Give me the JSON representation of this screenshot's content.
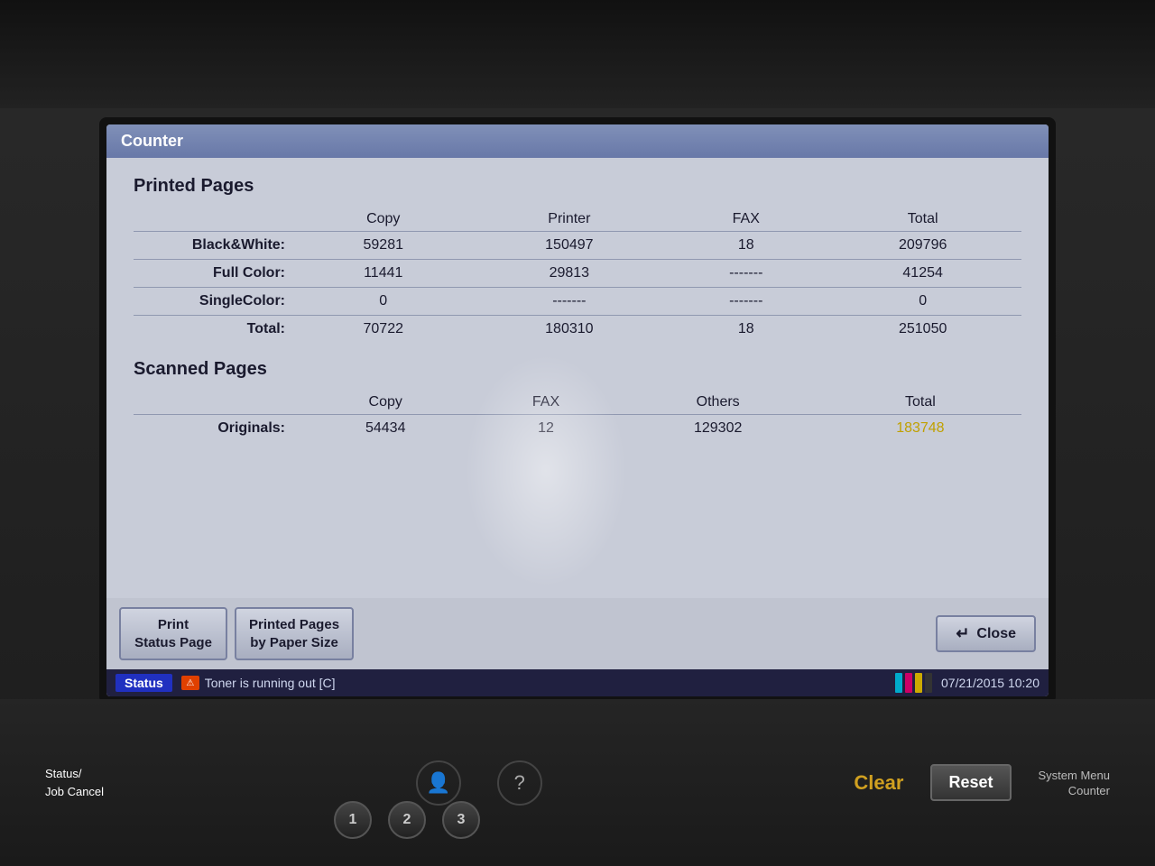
{
  "device": {
    "screen": {
      "title": "Counter",
      "titleBar": {
        "label": "Counter"
      },
      "printedPages": {
        "heading": "Printed Pages",
        "columns": [
          "",
          "Copy",
          "Printer",
          "FAX",
          "Total"
        ],
        "rows": [
          {
            "label": "Black&White:",
            "copy": "59281",
            "printer": "150497",
            "fax": "18",
            "total": "209796"
          },
          {
            "label": "Full Color:",
            "copy": "11441",
            "printer": "29813",
            "fax": "-------",
            "total": "41254"
          },
          {
            "label": "SingleColor:",
            "copy": "0",
            "printer": "-------",
            "fax": "-------",
            "total": "0"
          },
          {
            "label": "Total:",
            "copy": "70722",
            "printer": "180310",
            "fax": "18",
            "total": "251050"
          }
        ]
      },
      "scannedPages": {
        "heading": "Scanned Pages",
        "columns": [
          "",
          "Copy",
          "FAX",
          "Others",
          "Total"
        ],
        "rows": [
          {
            "label": "Originals:",
            "copy": "54434",
            "fax": "12",
            "others": "129302",
            "total": "183748"
          }
        ]
      },
      "buttons": {
        "printStatusPage": "Print\nStatus Page",
        "printedPagesByPaperSize": "Printed Pages\nby Paper Size",
        "close": "Close"
      },
      "statusBar": {
        "statusLabel": "Status",
        "tonerWarning": "Toner is running out  [C]",
        "datetime": "07/21/2015 10:20"
      }
    },
    "bottomPanel": {
      "statusJobCancel": "Status/\nJob Cancel",
      "clearLabel": "Clear",
      "resetLabel": "Reset",
      "systemMenuLabel": "System Menu",
      "counterLabel": "Counter",
      "numPad": [
        "1",
        "2",
        "3"
      ]
    }
  }
}
